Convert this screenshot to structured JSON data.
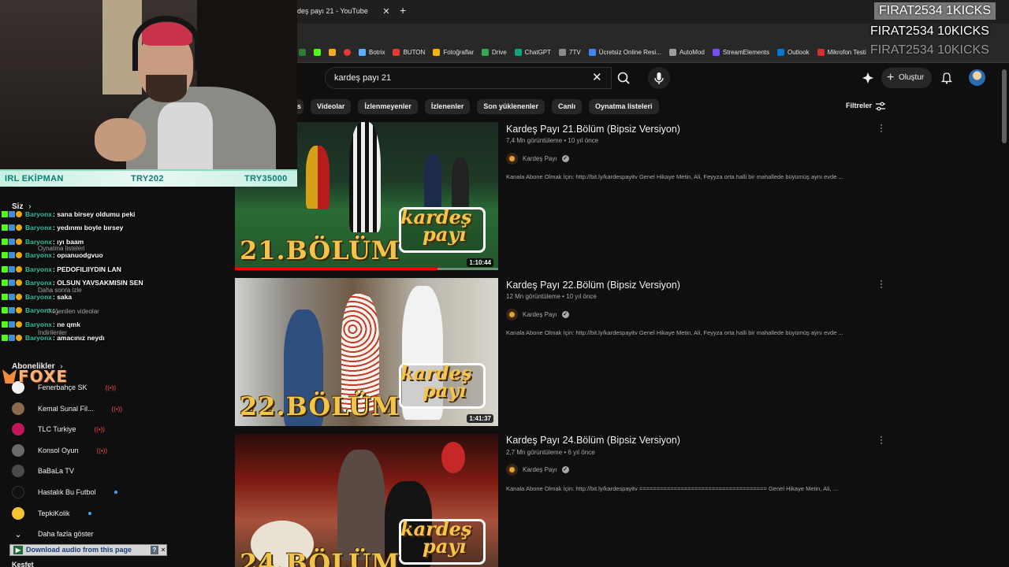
{
  "browser": {
    "tab_title": "deş payı 21 - YouTube",
    "bookmarks": [
      "Botrix",
      "BUTON",
      "Fotoğraflar",
      "Drive",
      "ChatGPT",
      "7TV",
      "Ücretsiz Online Resi...",
      "AutoMod",
      "StreamElements",
      "Outlook",
      "Mikrofon Testi"
    ],
    "bookmark_colors": [
      "#5db0ff",
      "#e53935",
      "#f4b400",
      "#34a853",
      "#10a37f",
      "#53fc18",
      "#4285f4",
      "#9e9e9e",
      "#7c4dff",
      "#0078d4",
      "#d32f2f"
    ]
  },
  "header": {
    "search_query": "kardeş payı 21",
    "create_label": "Oluştur"
  },
  "chips": [
    "s",
    "Videolar",
    "İzlenmeyenler",
    "İzlenenler",
    "Son yüklenenler",
    "Canlı",
    "Oynatma listeleri"
  ],
  "filters_label": "Filtreler",
  "results": [
    {
      "title": "Kardeş Payı 21.Bölüm (Bipsiz Versiyon)",
      "views": "7,4 Mn görüntüleme",
      "age": "10 yıl önce",
      "channel": "Kardeş Payı",
      "description": "Kanala Abone Olmak İçin: http://bit.ly/kardespayitv Genel Hikaye Metin, Ali, Feyyza orta halli bir mahallede büyümüş aynı evde ...",
      "duration": "1:10:44",
      "episode": "21.BÖLÜM",
      "watched": 0.77
    },
    {
      "title": "Kardeş Payı 22.Bölüm (Bipsiz Versiyon)",
      "views": "12 Mn görüntüleme",
      "age": "10 yıl önce",
      "channel": "Kardeş Payı",
      "description": "Kanala Abone Olmak İçin: http://bit.ly/kardespayitv Genel Hikaye Metin, Ali, Feyyza orta halli bir mahallede büyümüş aynı evde ...",
      "duration": "1:41:37",
      "episode": "22.BÖLÜM"
    },
    {
      "title": "Kardeş Payı 24.Bölüm (Bipsiz Versiyon)",
      "views": "2,7 Mn görüntüleme",
      "age": "6 yıl önce",
      "channel": "Kardeş Payı",
      "description": "Kanala Abone Olmak İçin: http://bit.ly/kardespayitv ===================================== Genel Hikaye Metin, Ali, ...",
      "episode": "24.BÖLÜM"
    }
  ],
  "brand_logo": [
    "kardeş",
    "payı"
  ],
  "sidebar": {
    "you_label": "Siz",
    "faded_items": [
      "Oynatma listeleri",
      "Daha sonra izle",
      "Beğenilen videolar",
      "İndirilenler"
    ],
    "subscriptions_label": "Abonelikler",
    "subscriptions": [
      {
        "name": "Fenerbahçe SK",
        "status": "live",
        "color": "#f2f2f2"
      },
      {
        "name": "Kemal Sunal Fil...",
        "status": "live",
        "color": "#8a6a4a"
      },
      {
        "name": "TLC Turkiye",
        "status": "live",
        "color": "#c2185b"
      },
      {
        "name": "Konsol Oyun",
        "status": "live",
        "color": "#6a6a6a"
      },
      {
        "name": "BaBaLa TV",
        "status": "none",
        "color": "#4a4a4a"
      },
      {
        "name": "Hastalık Bu Futbol",
        "status": "new",
        "color": "#111111"
      },
      {
        "name": "TepkiKolik",
        "status": "new",
        "color": "#f4c430"
      }
    ],
    "show_more": "Daha fazla göster",
    "next_section_cut": "Keşfet"
  },
  "chat": [
    {
      "user": "Baryonx",
      "msg": ": sana birsey oldumu peki"
    },
    {
      "user": "Baryonx",
      "msg": ": yedınmı boyle bırsey"
    },
    {
      "user": "Baryonx",
      "msg": ": ıyı baam"
    },
    {
      "user": "Baryonx",
      "msg": ": opıanuodgvuo"
    },
    {
      "user": "Baryonx",
      "msg": ": PEDOFILIIYDIN LAN"
    },
    {
      "user": "Baryonx",
      "msg": ": OLSUN YAVSAKMISIN SEN"
    },
    {
      "user": "Baryonx",
      "msg": ": saka"
    },
    {
      "user": "Baryonx",
      "msg": ": ."
    },
    {
      "user": "Baryonx",
      "msg": ": ne qmk"
    },
    {
      "user": "Baryonx",
      "msg": ": amacınız neydı"
    }
  ],
  "stream": {
    "bar_left": "IRL EKİPMAN",
    "bar_mid": "TRY202",
    "bar_right": "TRY35000",
    "kick_alerts": [
      "FIRAT2534  1KICKS",
      "FIRAT2534  10KICKS",
      "FIRAT2534  10KICKS"
    ],
    "logo": "FOXE"
  },
  "download_bar": {
    "label": "Download audio from this page",
    "help": "?",
    "close": "×"
  }
}
